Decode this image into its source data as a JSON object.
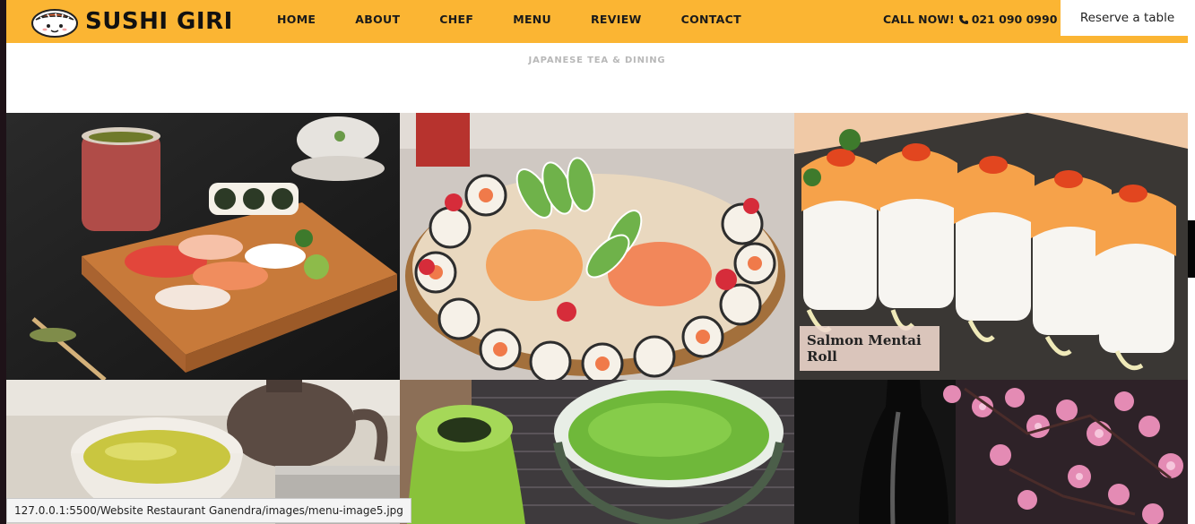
{
  "header": {
    "brand": "SUSHI GIRI",
    "nav": [
      "HOME",
      "ABOUT",
      "CHEF",
      "MENU",
      "REVIEW",
      "CONTACT"
    ],
    "call_label": "CALL NOW!",
    "phone": "021 090 0990",
    "reserve_label": "Reserve a table"
  },
  "tagline": "JAPANESE TEA & DINING",
  "gallery": {
    "caption": "Salmon Mentai Roll"
  },
  "statusbar": {
    "url": "127.0.0.1:5500/Website Restaurant Ganendra/images/menu-image5.jpg"
  },
  "colors": {
    "header_bg": "#fbb533",
    "text_dark": "#1a1a1a"
  }
}
